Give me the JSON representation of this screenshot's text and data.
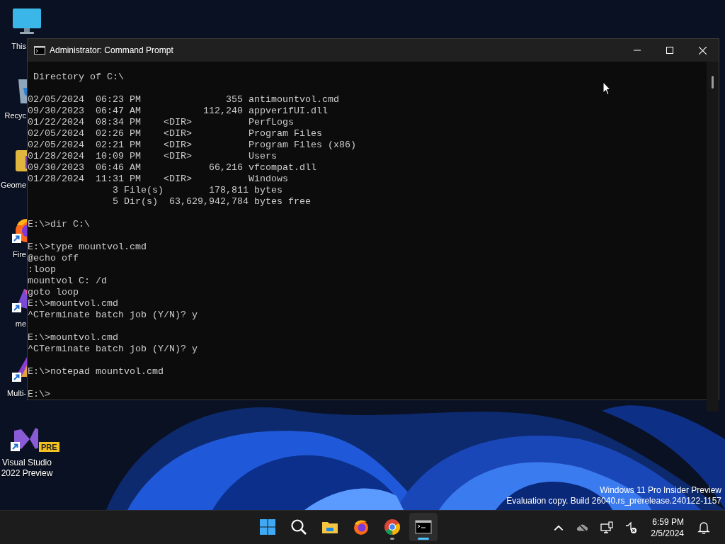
{
  "desktop_icons": [
    {
      "kind": "monitor",
      "label": "This",
      "shortcut": false,
      "cut_off": true,
      "icon_cut": false
    },
    {
      "kind": "recycle-bin",
      "label": "Recyc",
      "shortcut": false,
      "cut_off": true,
      "icon_cut": true
    },
    {
      "kind": "folder-app",
      "label": "Geome",
      "shortcut": false,
      "cut_off": true,
      "icon_cut": true
    },
    {
      "kind": "firefox",
      "label": "Fire",
      "shortcut": true,
      "cut_off": true,
      "icon_cut": true
    },
    {
      "kind": "purple-app",
      "label": "me",
      "shortcut": true,
      "cut_off": true,
      "icon_cut": true
    },
    {
      "kind": "triangle-app",
      "label": "Multi-",
      "shortcut": true,
      "cut_off": true,
      "icon_cut": true
    },
    {
      "kind": "visual-studio",
      "label": "Visual Studio 2022 Preview",
      "badge": "PRE",
      "shortcut": true,
      "cut_off": false,
      "icon_cut": false
    }
  ],
  "window": {
    "title": "Administrator: Command Prompt",
    "blocks": [
      [
        " Directory of C:\\"
      ],
      [
        "02/05/2024  06:23 PM               355 antimountvol.cmd",
        "09/30/2023  06:47 AM           112,240 appverifUI.dll",
        "01/22/2024  08:34 PM    <DIR>          PerfLogs",
        "02/05/2024  02:26 PM    <DIR>          Program Files",
        "02/05/2024  02:21 PM    <DIR>          Program Files (x86)",
        "01/28/2024  10:09 PM    <DIR>          Users",
        "09/30/2023  06:46 AM            66,216 vfcompat.dll",
        "01/28/2024  11:31 PM    <DIR>          Windows",
        "               3 File(s)        178,811 bytes",
        "               5 Dir(s)  63,629,942,784 bytes free"
      ],
      [
        "E:\\>dir C:\\"
      ],
      [
        "E:\\>type mountvol.cmd",
        "@echo off",
        ":loop",
        "mountvol C: /d",
        "goto loop",
        "E:\\>mountvol.cmd",
        "^CTerminate batch job (Y/N)? y"
      ],
      [
        "E:\\>mountvol.cmd",
        "^CTerminate batch job (Y/N)? y"
      ],
      [
        "E:\\>notepad mountvol.cmd"
      ],
      [
        "E:\\>"
      ]
    ]
  },
  "watermark": [
    "Windows 11 Pro Insider Preview",
    "Evaluation copy. Build 26040.rs_prerelease.240122-1157"
  ],
  "taskbar": {
    "apps": [
      {
        "kind": "start",
        "running": false,
        "selected": false
      },
      {
        "kind": "search",
        "running": false,
        "selected": false
      },
      {
        "kind": "explorer",
        "running": false,
        "selected": false
      },
      {
        "kind": "firefox",
        "running": false,
        "selected": false
      },
      {
        "kind": "chrome",
        "running": true,
        "selected": false
      },
      {
        "kind": "terminal",
        "running": true,
        "selected": true
      }
    ],
    "time": "6:59 PM",
    "date": "2/5/2024"
  }
}
